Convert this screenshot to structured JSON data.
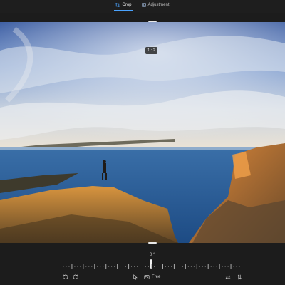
{
  "tabs": [
    {
      "label": "Crop",
      "icon": "crop-icon",
      "active": true
    },
    {
      "label": "Adjustment",
      "icon": "adjustment-icon",
      "active": false
    }
  ],
  "crop": {
    "aspect_ratio_label": "1 : 2",
    "rotation_angle": "0 °",
    "aspect_mode_label": "Free"
  },
  "toolbar": {
    "rotate_left_icon": "rotate-left-icon",
    "rotate_right_icon": "rotate-right-icon",
    "pointer_icon": "pointer-icon",
    "aspect_icon": "aspect-ratio-icon",
    "flip_horizontal_icon": "flip-horizontal-icon",
    "flip_vertical_icon": "flip-vertical-icon"
  },
  "colors": {
    "background": "#1c1c1c",
    "accent": "#4aa3ff"
  }
}
